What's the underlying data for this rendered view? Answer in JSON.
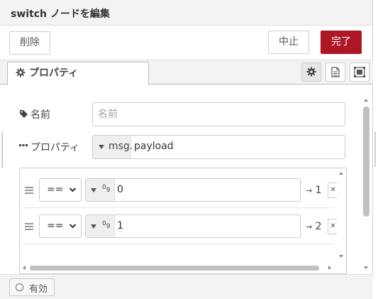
{
  "header": {
    "title": "switch ノードを編集"
  },
  "tray": {
    "delete_label": "削除",
    "cancel_label": "中止",
    "done_label": "完了"
  },
  "tabs": [
    {
      "label": "プロパティ",
      "icon": "gear-icon"
    }
  ],
  "tab_buttons": [
    {
      "icon": "gear-icon",
      "active": true
    },
    {
      "icon": "description-icon"
    },
    {
      "icon": "appearance-icon"
    }
  ],
  "form": {
    "name": {
      "label": "名前",
      "value": "",
      "placeholder": "名前"
    },
    "property": {
      "label": "プロパティ",
      "prefix": "msg.",
      "value": "payload"
    }
  },
  "rules": [
    {
      "operator": "==",
      "type": "09",
      "value": "0",
      "output": "1"
    },
    {
      "operator": "==",
      "type": "09",
      "value": "1",
      "output": "2"
    }
  ],
  "footer": {
    "enabled_label": "有効"
  },
  "colors": {
    "done_button": "#ad1625",
    "header_bg": "#f3f3f3"
  }
}
